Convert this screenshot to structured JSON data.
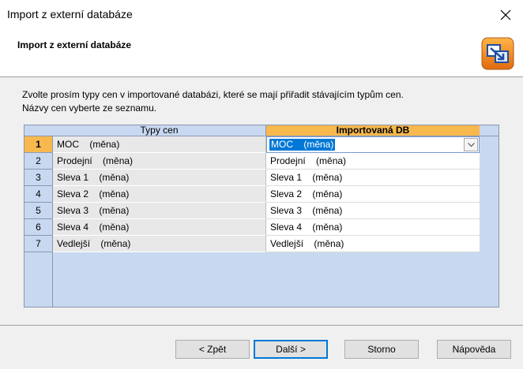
{
  "window": {
    "title": "Import z externí databáze",
    "header_title": "Import z externí databáze"
  },
  "instructions": {
    "line1": "Zvolte prosím typy cen v importované databázi, které se mají přiřadit stávajícím typům cen.",
    "line2": "Názvy cen vyberte ze seznamu."
  },
  "grid": {
    "col_types": "Typy cen",
    "col_db": "Importovaná DB",
    "selected_row": 1,
    "rows": [
      {
        "num": "1",
        "type": "MOC    (měna)",
        "db": "MOC    (měna)"
      },
      {
        "num": "2",
        "type": "Prodejní    (měna)",
        "db": "Prodejní    (měna)"
      },
      {
        "num": "3",
        "type": "Sleva 1    (měna)",
        "db": "Sleva 1    (měna)"
      },
      {
        "num": "4",
        "type": "Sleva 2    (měna)",
        "db": "Sleva 2    (měna)"
      },
      {
        "num": "5",
        "type": "Sleva 3    (měna)",
        "db": "Sleva 3    (měna)"
      },
      {
        "num": "6",
        "type": "Sleva 4    (měna)",
        "db": "Sleva 4    (měna)"
      },
      {
        "num": "7",
        "type": "Vedlejší    (měna)",
        "db": "Vedlejší    (měna)"
      }
    ]
  },
  "buttons": {
    "back": "< Zpět",
    "next": "Další >",
    "cancel": "Storno",
    "help": "Nápověda"
  },
  "icons": {
    "close": "close-icon",
    "wizard": "import-database-icon",
    "dropdown": "chevron-down-icon"
  },
  "colors": {
    "accent_orange": "#f7b84e",
    "grid_blue": "#c8d8f0",
    "selection_blue": "#0078d7"
  }
}
